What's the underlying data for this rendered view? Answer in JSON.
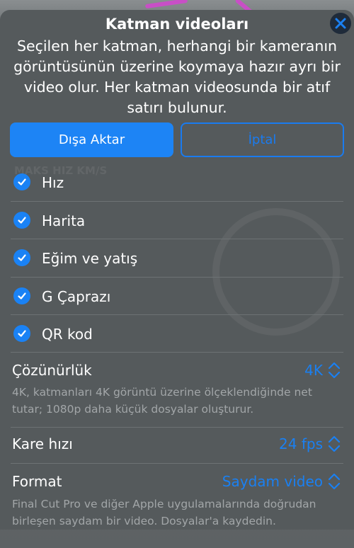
{
  "sheet": {
    "title": "Katman videoları",
    "description": "Seçilen her katman, herhangi bir kameranın görüntüsünün üzerine koymaya hazır ayrı bir video olur. Her katman videosunda bir atıf satırı bulunur.",
    "close_icon": "close-icon"
  },
  "actions": {
    "export_label": "Dışa Aktar",
    "cancel_label": "İptal"
  },
  "layers": [
    {
      "label": "Hız",
      "checked": true
    },
    {
      "label": "Harita",
      "checked": true
    },
    {
      "label": "Eğim ve yatış",
      "checked": true
    },
    {
      "label": "G Çaprazı",
      "checked": true
    },
    {
      "label": "QR kod",
      "checked": true
    }
  ],
  "settings": {
    "resolution": {
      "label": "Çözünürlük",
      "value": "4K",
      "description": "4K, katmanları 4K görüntü üzerine ölçeklendiğinde net tutar; 1080p daha küçük dosyalar oluşturur."
    },
    "frame_rate": {
      "label": "Kare hızı",
      "value": "24 fps"
    },
    "format": {
      "label": "Format",
      "value": "Saydam video",
      "description": "Final Cut Pro ve diğer Apple uygulamalarında doğrudan birleşen saydam bir video. Dosyalar'a kaydedin."
    }
  },
  "colors": {
    "accent": "#1a80f2",
    "sheet_bg": "#555a5c",
    "secondary_text": "#a2a6a8"
  }
}
